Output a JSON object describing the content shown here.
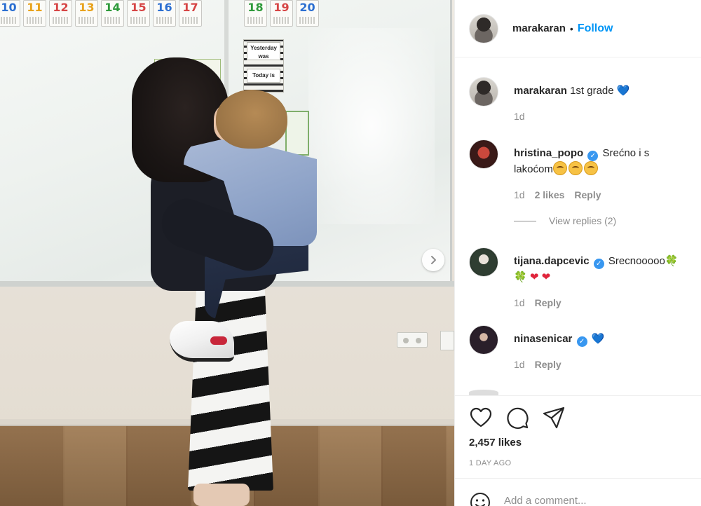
{
  "photo": {
    "cards_left": [
      {
        "num": "10",
        "color": "#2c6fd1"
      },
      {
        "num": "11",
        "color": "#e8a21b"
      },
      {
        "num": "12",
        "color": "#d64545"
      },
      {
        "num": "13",
        "color": "#e8a21b"
      },
      {
        "num": "14",
        "color": "#2e9a3a"
      },
      {
        "num": "15",
        "color": "#d64545"
      },
      {
        "num": "16",
        "color": "#2c6fd1"
      },
      {
        "num": "17",
        "color": "#d64545"
      }
    ],
    "cards_right": [
      {
        "num": "18",
        "color": "#2e9a3a"
      },
      {
        "num": "19",
        "color": "#d64545"
      },
      {
        "num": "20",
        "color": "#2c6fd1"
      }
    ],
    "poster_yesterday": "Yesterday was",
    "poster_today": "Today is",
    "next_icon": "chevron-right-icon"
  },
  "header": {
    "username": "marakaran",
    "separator": "•",
    "follow_label": "Follow"
  },
  "caption": {
    "username": "marakaran",
    "text": "1st grade",
    "emoji": "💙",
    "time": "1d"
  },
  "comments": [
    {
      "username": "hristina_popo",
      "verified": true,
      "text_line1": "Srećno i s",
      "text_line2": "lakoćom",
      "time": "1d",
      "likes": "2 likes",
      "reply": "Reply"
    },
    {
      "username": "tijana.dapcevic",
      "verified": true,
      "text": "Srecnooooo",
      "emoji_line1": "🍀",
      "emoji_line2a": "🍀",
      "emoji_line2b": "❤",
      "emoji_line2c": "❤",
      "time": "1d",
      "reply": "Reply"
    },
    {
      "username": "ninasenicar",
      "verified": true,
      "emoji": "💙",
      "time": "1d",
      "reply": "Reply"
    }
  ],
  "view_replies": "View replies (2)",
  "actions": {
    "likes": "2,457 likes",
    "time_ago": "1 DAY AGO"
  },
  "add_comment": {
    "placeholder": "Add a comment..."
  },
  "icons": {
    "like": "heart-icon",
    "comment": "comment-icon",
    "share": "paper-plane-icon",
    "emoji": "smiley-icon",
    "verified": "verified-badge-icon"
  },
  "colors": {
    "accent": "#0095f6",
    "text": "#262626",
    "muted": "#8e8e8e",
    "verified": "#3897f0"
  }
}
